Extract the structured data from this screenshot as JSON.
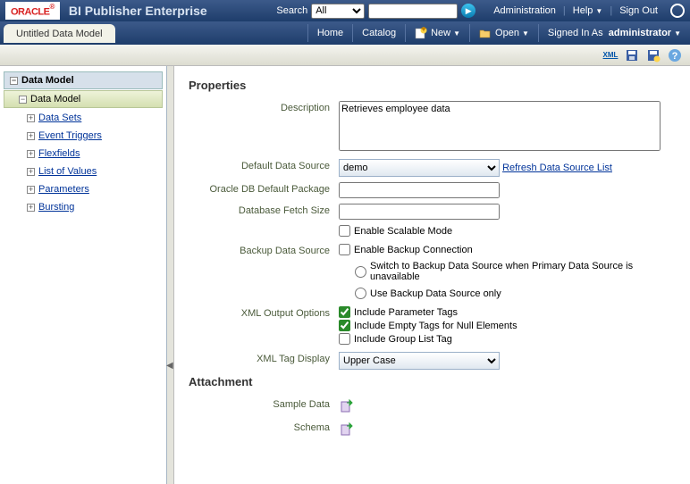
{
  "header": {
    "logo": "ORACLE",
    "app_title": "BI Publisher Enterprise",
    "search_label": "Search",
    "search_option": "All",
    "links": {
      "admin": "Administration",
      "help": "Help",
      "signout": "Sign Out"
    }
  },
  "nav": {
    "tab": "Untitled Data Model",
    "home": "Home",
    "catalog": "Catalog",
    "new": "New",
    "open": "Open",
    "signed_in": "Signed In As",
    "user": "administrator"
  },
  "toolbar": {
    "xml": "XML"
  },
  "tree": {
    "root": "Data Model",
    "selected": "Data Model",
    "items": [
      "Data Sets",
      "Event Triggers",
      "Flexfields",
      "List of Values",
      "Parameters",
      "Bursting"
    ]
  },
  "props": {
    "title": "Properties",
    "labels": {
      "description": "Description",
      "default_ds": "Default Data Source",
      "db_pkg": "Oracle DB Default Package",
      "fetch": "Database Fetch Size",
      "backup_ds": "Backup Data Source",
      "xml_out": "XML Output Options",
      "xml_tag": "XML Tag Display"
    },
    "description_value": "Retrieves employee data",
    "default_ds_value": "demo",
    "refresh_link": "Refresh Data Source List",
    "enable_scalable": "Enable Scalable Mode",
    "enable_backup": "Enable Backup Connection",
    "backup_opt1": "Switch to Backup Data Source when Primary Data Source is unavailable",
    "backup_opt2": "Use Backup Data Source only",
    "xml_param": "Include Parameter Tags",
    "xml_empty": "Include Empty Tags for Null Elements",
    "xml_group": "Include Group List Tag",
    "xml_tag_value": "Upper Case"
  },
  "attach": {
    "title": "Attachment",
    "sample": "Sample Data",
    "schema": "Schema"
  }
}
